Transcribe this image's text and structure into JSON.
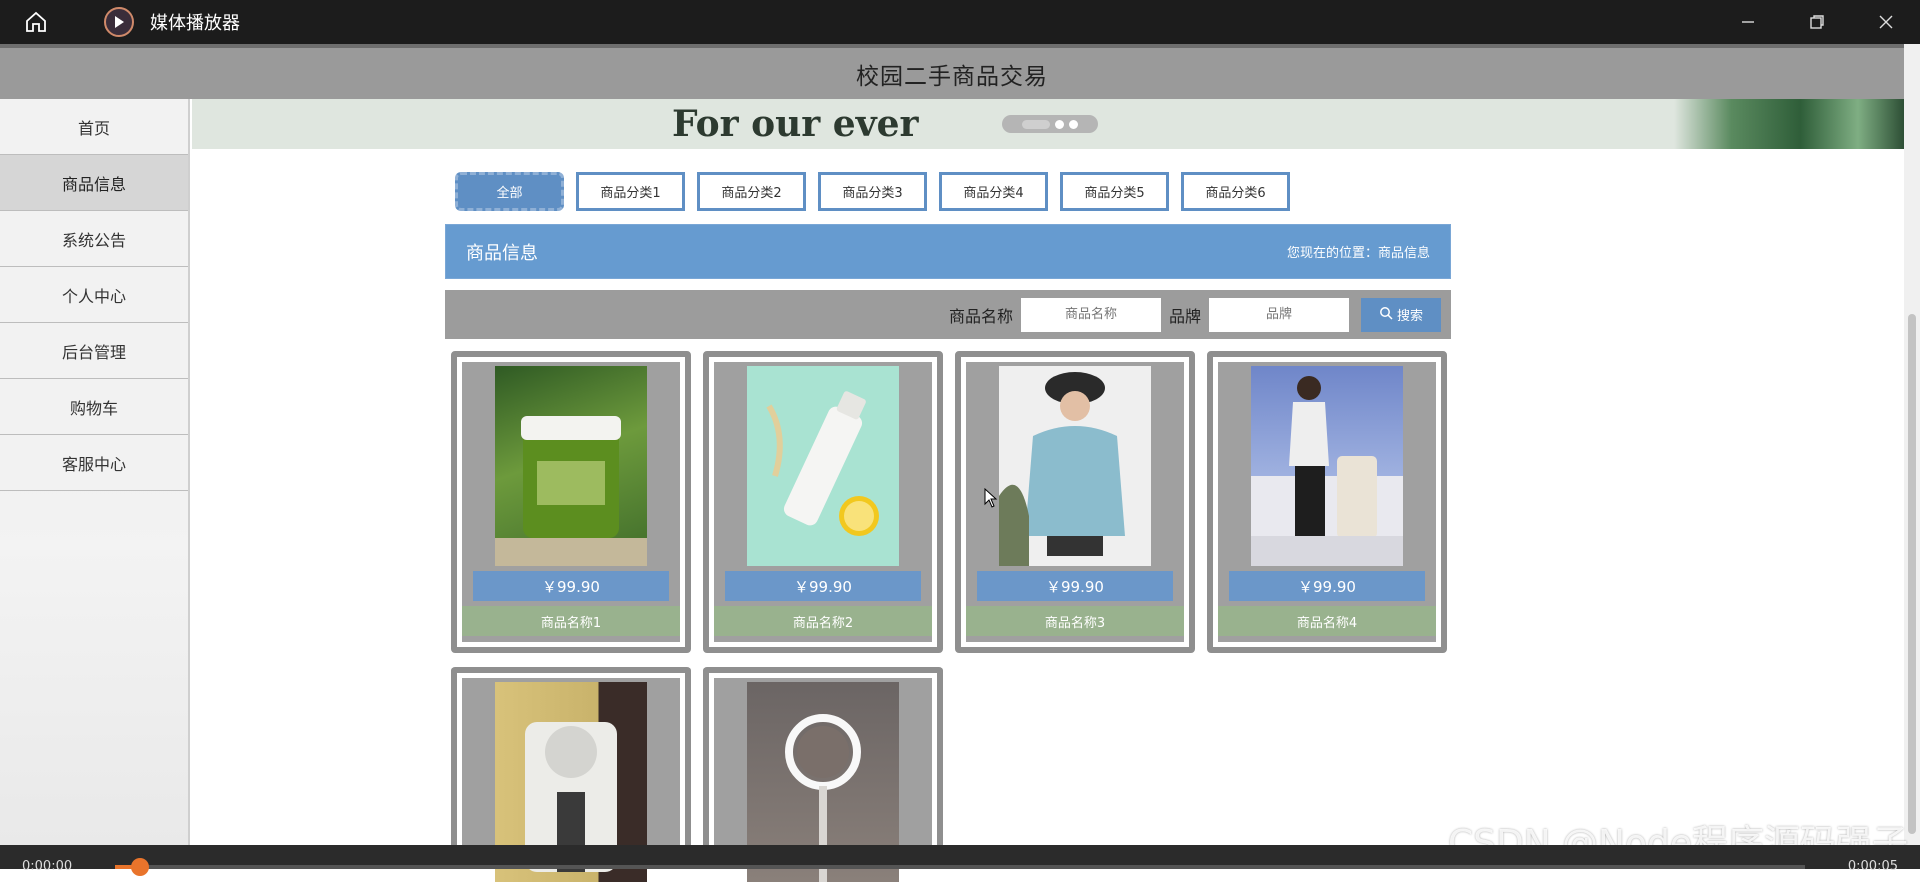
{
  "player": {
    "title": "媒体播放器",
    "time_elapsed": "0:00:00",
    "time_total": "0:00:05",
    "progress": 0.01,
    "icons": [
      "home-icon",
      "play-icon",
      "minimize-icon",
      "restore-icon",
      "close-icon"
    ]
  },
  "site": {
    "title": "校园二手商品交易",
    "banner_text": "For our ever"
  },
  "sidebar": {
    "items": [
      {
        "label": "首页"
      },
      {
        "label": "商品信息"
      },
      {
        "label": "系统公告"
      },
      {
        "label": "个人中心"
      },
      {
        "label": "后台管理"
      },
      {
        "label": "购物车"
      },
      {
        "label": "客服中心"
      }
    ],
    "active": "商品信息"
  },
  "categories": {
    "items": [
      "全部",
      "商品分类1",
      "商品分类2",
      "商品分类3",
      "商品分类4",
      "商品分类5",
      "商品分类6"
    ],
    "active": "全部"
  },
  "section": {
    "title": "商品信息",
    "location": "您现在的位置：商品信息"
  },
  "search": {
    "name_label": "商品名称",
    "name_placeholder": "商品名称",
    "brand_label": "品牌",
    "brand_placeholder": "品牌",
    "button_label": "搜索"
  },
  "products": [
    {
      "price": "￥99.90",
      "name": "商品名称1",
      "image": "green-face-mask-jar"
    },
    {
      "price": "￥99.90",
      "name": "商品名称2",
      "image": "white-foam-bottle-with-lemon"
    },
    {
      "price": "￥99.90",
      "name": "商品名称3",
      "image": "person-in-blue-hoodie"
    },
    {
      "price": "￥99.90",
      "name": "商品名称4",
      "image": "person-with-suitcase"
    },
    {
      "price": "",
      "name": "",
      "image": "white-device-on-stand"
    },
    {
      "price": "",
      "name": "",
      "image": "ring-light-mirror"
    }
  ],
  "watermark": "CSDN @Node程序源码强子",
  "colors": {
    "accent": "#669bd0",
    "tab_border": "#5f8fc4",
    "price_bg": "#6b97c9",
    "name_bg": "#99b28e",
    "header_bg": "#9a9a9a"
  }
}
